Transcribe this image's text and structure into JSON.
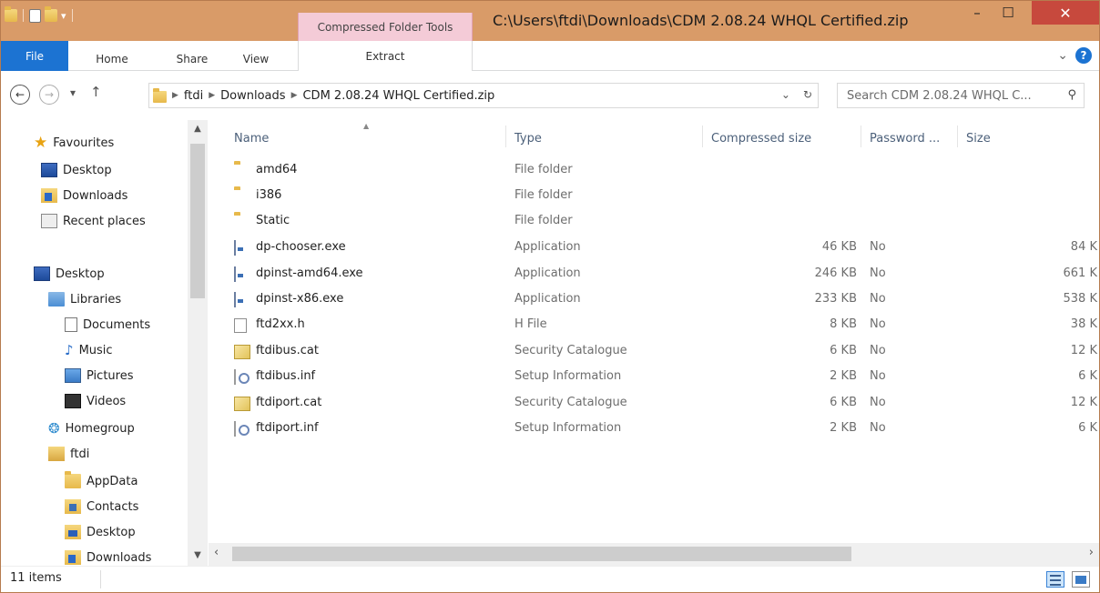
{
  "window": {
    "title": "C:\\Users\\ftdi\\Downloads\\CDM 2.08.24 WHQL Certified.zip",
    "context_tab": "Compressed Folder Tools",
    "minimize": "–",
    "maximize": "☐",
    "close": "✕"
  },
  "ribbon": {
    "file": "File",
    "tabs": [
      "Home",
      "Share",
      "View"
    ],
    "extract": "Extract",
    "expand": "⌄",
    "help": "?"
  },
  "address": {
    "breadcrumb": [
      "ftdi",
      "Downloads",
      "CDM 2.08.24 WHQL Certified.zip"
    ],
    "search_placeholder": "Search CDM 2.08.24 WHQL C..."
  },
  "nav": {
    "items": [
      {
        "label": "Favourites",
        "icon": "star-icon"
      },
      {
        "label": "Desktop",
        "icon": "desktop-icon"
      },
      {
        "label": "Downloads",
        "icon": "downloads-icon"
      },
      {
        "label": "Recent places",
        "icon": "recent-places-icon"
      },
      {
        "label": "Desktop",
        "icon": "desktop-icon"
      },
      {
        "label": "Libraries",
        "icon": "libraries-icon"
      },
      {
        "label": "Documents",
        "icon": "documents-icon"
      },
      {
        "label": "Music",
        "icon": "music-icon"
      },
      {
        "label": "Pictures",
        "icon": "pictures-icon"
      },
      {
        "label": "Videos",
        "icon": "videos-icon"
      },
      {
        "label": "Homegroup",
        "icon": "homegroup-icon"
      },
      {
        "label": "ftdi",
        "icon": "user-folder-icon"
      },
      {
        "label": "AppData",
        "icon": "folder-icon"
      },
      {
        "label": "Contacts",
        "icon": "contacts-icon"
      },
      {
        "label": "Desktop",
        "icon": "desktop-folder-icon"
      },
      {
        "label": "Downloads",
        "icon": "downloads-icon"
      }
    ]
  },
  "columns": {
    "name": "Name",
    "type": "Type",
    "compressed": "Compressed size",
    "password": "Password ...",
    "size": "Size"
  },
  "files": [
    {
      "name": "amd64",
      "type": "File folder",
      "compressed": "",
      "password": "",
      "size": "",
      "icon": "folder-icon"
    },
    {
      "name": "i386",
      "type": "File folder",
      "compressed": "",
      "password": "",
      "size": "",
      "icon": "folder-icon"
    },
    {
      "name": "Static",
      "type": "File folder",
      "compressed": "",
      "password": "",
      "size": "",
      "icon": "folder-icon"
    },
    {
      "name": "dp-chooser.exe",
      "type": "Application",
      "compressed": "46 KB",
      "password": "No",
      "size": "84 K",
      "icon": "application-icon"
    },
    {
      "name": "dpinst-amd64.exe",
      "type": "Application",
      "compressed": "246 KB",
      "password": "No",
      "size": "661 K",
      "icon": "application-icon"
    },
    {
      "name": "dpinst-x86.exe",
      "type": "Application",
      "compressed": "233 KB",
      "password": "No",
      "size": "538 K",
      "icon": "application-icon"
    },
    {
      "name": "ftd2xx.h",
      "type": "H File",
      "compressed": "8 KB",
      "password": "No",
      "size": "38 K",
      "icon": "file-icon"
    },
    {
      "name": "ftdibus.cat",
      "type": "Security Catalogue",
      "compressed": "6 KB",
      "password": "No",
      "size": "12 K",
      "icon": "security-catalogue-icon"
    },
    {
      "name": "ftdibus.inf",
      "type": "Setup Information",
      "compressed": "2 KB",
      "password": "No",
      "size": "6 K",
      "icon": "setup-information-icon"
    },
    {
      "name": "ftdiport.cat",
      "type": "Security Catalogue",
      "compressed": "6 KB",
      "password": "No",
      "size": "12 K",
      "icon": "security-catalogue-icon"
    },
    {
      "name": "ftdiport.inf",
      "type": "Setup Information",
      "compressed": "2 KB",
      "password": "No",
      "size": "6 K",
      "icon": "setup-information-icon"
    }
  ],
  "status": {
    "count": "11 items"
  },
  "colors": {
    "titlebar": "#d99b68",
    "file_tab": "#1c73d2",
    "context_tab": "#f4cbd7",
    "close": "#c7493d"
  }
}
